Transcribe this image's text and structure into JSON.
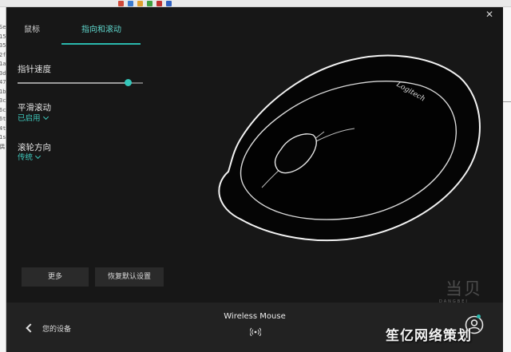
{
  "tabs": [
    {
      "label": "鼠标",
      "active": false
    },
    {
      "label": "指向和滚动",
      "active": true
    }
  ],
  "pointer_speed": {
    "title": "指针速度",
    "level_percent": 88
  },
  "smooth_scroll": {
    "title": "平滑滚动",
    "value": "已启用"
  },
  "wheel_direction": {
    "title": "滚轮方向",
    "value": "传统"
  },
  "buttons": {
    "more": "更多",
    "restore_defaults": "恢复默认设置"
  },
  "mouse_brand": "Logitech",
  "bottom": {
    "back_label": "您的设备",
    "device_name": "Wireless Mouse"
  },
  "desktop_left_text": [
    "Se",
    "15",
    "35",
    "2f",
    "1a",
    "3d",
    "47",
    "1b",
    "3c",
    "6c",
    "6t",
    "4t",
    "1s",
    "偶"
  ],
  "watermark": {
    "line1": "当贝",
    "sub": "DANGBEI",
    "line2": "笙亿网络策划"
  },
  "colors": {
    "accent": "#2ab8ad",
    "background": "#171717",
    "bottom_bar": "#222222"
  }
}
